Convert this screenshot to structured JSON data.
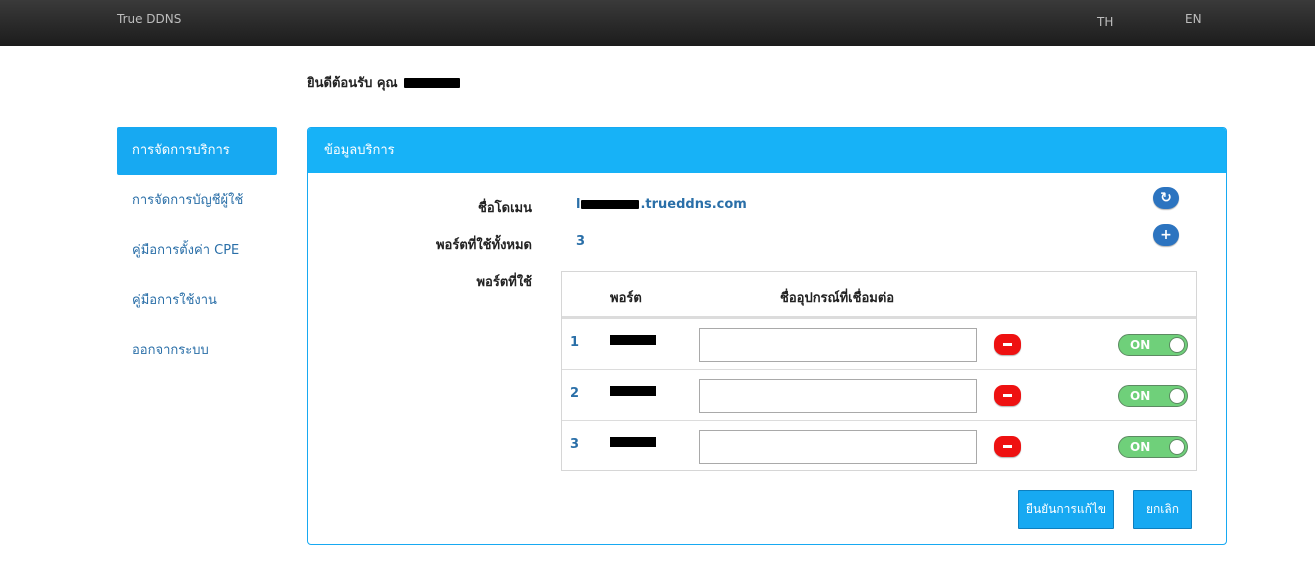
{
  "header": {
    "brand": "True DDNS",
    "lang_th": "TH",
    "lang_en": "EN"
  },
  "welcome": {
    "text": "ยินดีต้อนรับ คุณ"
  },
  "sidebar": {
    "items": [
      {
        "label": "การจัดการบริการ",
        "active": true
      },
      {
        "label": "การจัดการบัญชีผู้ใช้",
        "active": false
      },
      {
        "label": "คู่มือการตั้งค่า CPE",
        "active": false
      },
      {
        "label": "คู่มือการใช้งาน",
        "active": false
      },
      {
        "label": "ออกจากระบบ",
        "active": false
      }
    ]
  },
  "panel": {
    "title": "ข้อมูลบริการ",
    "domain_label": "ชื่อโดเมน",
    "domain_prefix": "l",
    "domain_suffix": ".trueddns.com",
    "ports_total_label": "พอร์ตที่ใช้ทั้งหมด",
    "ports_total_value": "3",
    "ports_used_label": "พอร์ตที่ใช้",
    "table": {
      "col_port": "พอร์ต",
      "col_device": "ชื่ออุปกรณ์ที่เชื่อมต่อ",
      "rows": [
        {
          "num": "1",
          "device": "",
          "toggle": "ON"
        },
        {
          "num": "2",
          "device": "",
          "toggle": "ON"
        },
        {
          "num": "3",
          "device": "",
          "toggle": "ON"
        }
      ]
    },
    "confirm_label": "ยืนยันการแก้ไข",
    "cancel_label": "ยกเลิก"
  },
  "icons": {
    "refresh": "refresh-icon",
    "add": "plus-icon",
    "remove": "minus-icon"
  },
  "colors": {
    "accent": "#17a9f2",
    "link": "#2a6fa8",
    "danger": "#ee1111",
    "toggle_on": "#6fd07a"
  }
}
